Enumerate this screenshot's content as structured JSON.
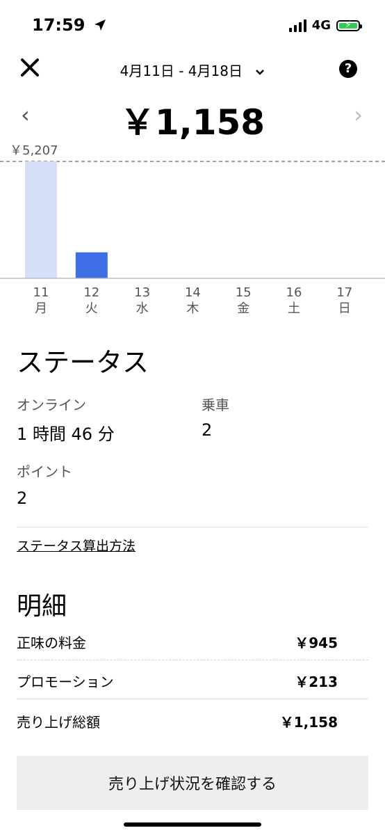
{
  "status_bar": {
    "time": "17:59",
    "network": "4G",
    "location_icon": "location-arrow-icon"
  },
  "header": {
    "date_range": "4月11日 - 4月18日",
    "close_icon": "close-icon",
    "help_icon": "help-icon"
  },
  "summary": {
    "total": "￥1,158"
  },
  "chart_data": {
    "type": "bar",
    "max_label": "￥5,207",
    "max_value": 5207,
    "categories": [
      "11",
      "12",
      "13",
      "14",
      "15",
      "16",
      "17"
    ],
    "weekdays": [
      "月",
      "火",
      "水",
      "木",
      "金",
      "土",
      "日"
    ],
    "values": [
      5207,
      1158,
      0,
      0,
      0,
      0,
      0
    ],
    "highlight_index": 1,
    "colors": {
      "previous": "#d5e0f8",
      "current": "#3f6fe6",
      "axis": "#bbbbbb",
      "max_line": "#666666"
    }
  },
  "stats": {
    "heading": "ステータス",
    "online_label": "オンライン",
    "online_value": "1 時間 46 分",
    "rides_label": "乗車",
    "rides_value": "2",
    "points_label": "ポイント",
    "points_value": "2",
    "link": "ステータス算出方法"
  },
  "breakdown": {
    "heading": "明細",
    "rows": [
      {
        "label": "正味の料金",
        "amount": "￥945"
      },
      {
        "label": "プロモーション",
        "amount": "￥213"
      },
      {
        "label": "売り上げ総額",
        "amount": "￥1,158"
      }
    ]
  },
  "button": {
    "label": "売り上げ状況を確認する"
  }
}
